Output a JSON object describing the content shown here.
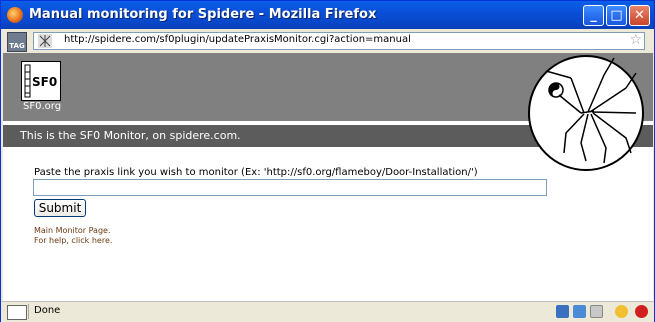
{
  "window": {
    "title": "Manual monitoring for Spidere - Mozilla Firefox",
    "buttons": {
      "minimize": "_",
      "maximize": "□",
      "close": "✕"
    }
  },
  "addressbar": {
    "tag_label": "TAG",
    "url": "http://spidere.com/sf0plugin/updatePraxisMonitor.cgi?action=manual"
  },
  "page": {
    "logo_text": "SF0",
    "logo_label": "SF0.org",
    "banner_text": "This is the SF0 Monitor, on spidere.com.",
    "prompt": "Paste the praxis link you wish to monitor (Ex: 'http://sf0.org/flameboy/Door-Installation/')",
    "input_value": "",
    "submit_label": "Submit",
    "link_main": "Main Monitor Page.",
    "help_prefix": "For help, ",
    "help_link": "click here."
  },
  "statusbar": {
    "text": "Done"
  }
}
